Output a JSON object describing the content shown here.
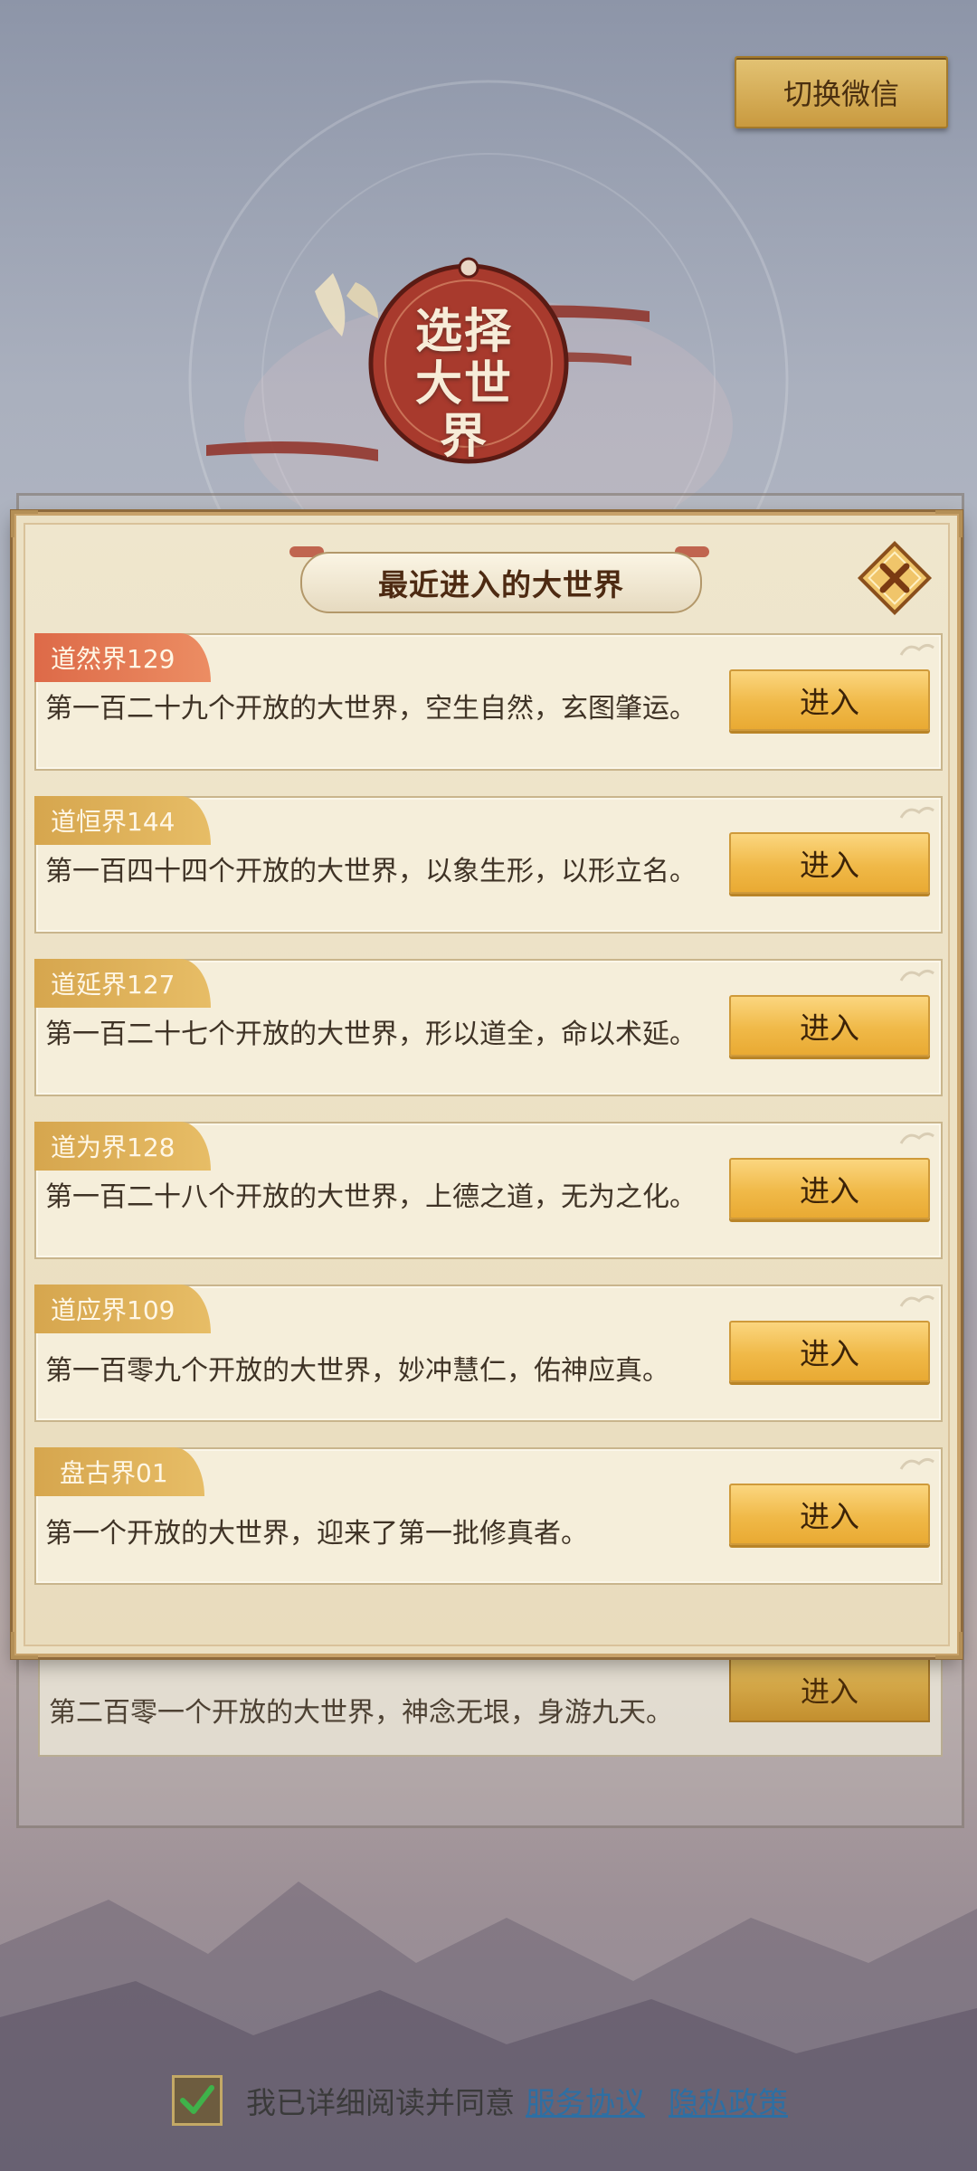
{
  "header": {
    "switch_button": "切换微信"
  },
  "emblem": {
    "title": "选择大世界"
  },
  "modal": {
    "title": "最近进入的大世界",
    "worlds": [
      {
        "name": "道然界129",
        "desc": "第一百二十九个开放的大世界，空生自然，玄图肇运。",
        "enter": "进入"
      },
      {
        "name": "道恒界144",
        "desc": "第一百四十四个开放的大世界，以象生形，以形立名。",
        "enter": "进入"
      },
      {
        "name": "道延界127",
        "desc": "第一百二十七个开放的大世界，形以道全，命以术延。",
        "enter": "进入"
      },
      {
        "name": "道为界128",
        "desc": "第一百二十八个开放的大世界，上德之道，无为之化。",
        "enter": "进入"
      },
      {
        "name": "道应界109",
        "desc": "第一百零九个开放的大世界，妙冲慧仁，佑神应真。",
        "enter": "进入"
      },
      {
        "name": "盘古界01",
        "desc": "第一个开放的大世界，迎来了第一批修真者。",
        "enter": "进入"
      }
    ]
  },
  "background_list": {
    "desc": "第二百零一个开放的大世界，神念无垠，身游九天。",
    "enter": "进入"
  },
  "agreement": {
    "text": "我已详细阅读并同意",
    "service_link": "服务协议",
    "privacy_link": "隐私政策",
    "checked": true
  }
}
